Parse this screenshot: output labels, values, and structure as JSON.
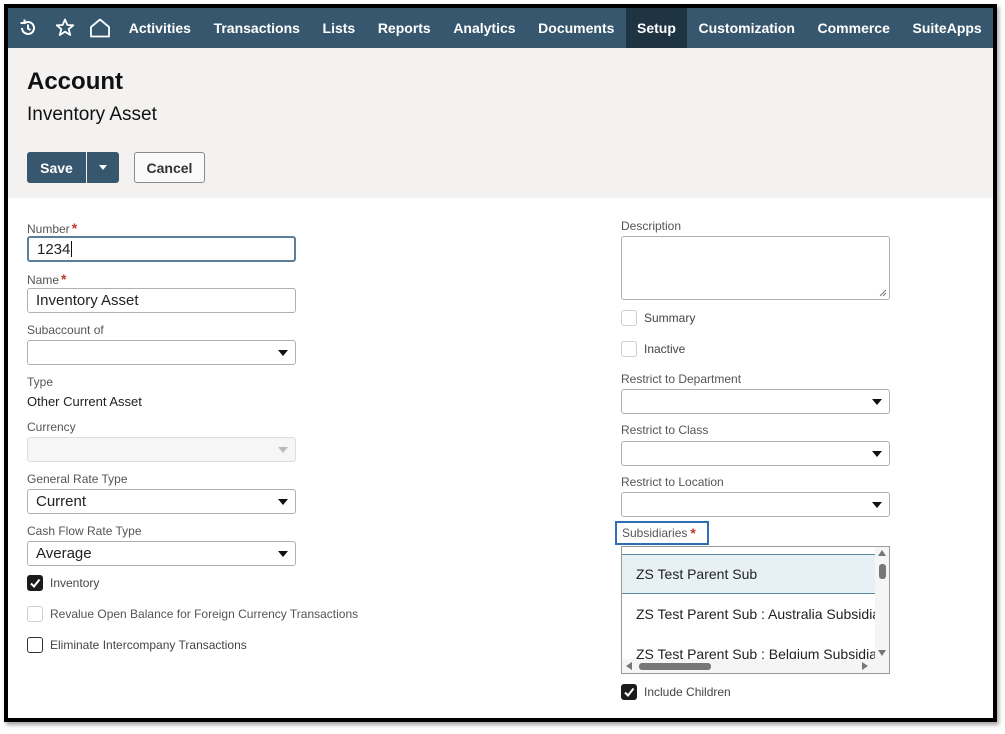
{
  "nav": {
    "items": [
      "Activities",
      "Transactions",
      "Lists",
      "Reports",
      "Analytics",
      "Documents",
      "Setup",
      "Customization",
      "Commerce",
      "SuiteApps"
    ],
    "active": "Setup",
    "icons": [
      "history-icon",
      "star-icon",
      "home-icon"
    ]
  },
  "header": {
    "title": "Account",
    "subtitle": "Inventory Asset",
    "save_label": "Save",
    "cancel_label": "Cancel"
  },
  "form": {
    "number": {
      "label": "Number",
      "value": "1234",
      "required": true
    },
    "name": {
      "label": "Name",
      "value": "Inventory Asset",
      "required": true
    },
    "subaccount": {
      "label": "Subaccount of",
      "value": ""
    },
    "type": {
      "label": "Type",
      "value": "Other Current Asset"
    },
    "currency": {
      "label": "Currency",
      "value": "",
      "disabled": true
    },
    "general_rate_type": {
      "label": "General Rate Type",
      "value": "Current"
    },
    "cash_flow_rate_type": {
      "label": "Cash Flow Rate Type",
      "value": "Average"
    },
    "inventory": {
      "label": "Inventory",
      "checked": true
    },
    "revalue": {
      "label": "Revalue Open Balance for Foreign Currency Transactions",
      "checked": false,
      "disabled": true
    },
    "eliminate": {
      "label": "Eliminate Intercompany Transactions",
      "checked": false
    },
    "description": {
      "label": "Description",
      "value": ""
    },
    "summary": {
      "label": "Summary",
      "checked": false,
      "disabled": true
    },
    "inactive": {
      "label": "Inactive",
      "checked": false,
      "disabled": true
    },
    "restrict_department": {
      "label": "Restrict to Department",
      "value": ""
    },
    "restrict_class": {
      "label": "Restrict to Class",
      "value": ""
    },
    "restrict_location": {
      "label": "Restrict to Location",
      "value": ""
    },
    "subsidiaries": {
      "label": "Subsidiaries",
      "required": true,
      "options": [
        "ZS Test Parent Sub",
        "ZS Test Parent Sub : Australia Subsidiary",
        "ZS Test Parent Sub : Belgium Subsidiary"
      ],
      "selected_index": 0
    },
    "include_children": {
      "label": "Include Children",
      "checked": true
    }
  },
  "colors": {
    "nav_bg": "#36576d",
    "nav_active": "#1f3443",
    "header_bg": "#f3f2f1",
    "required": "#c0392b",
    "focus_outline": "#2f6db5"
  }
}
